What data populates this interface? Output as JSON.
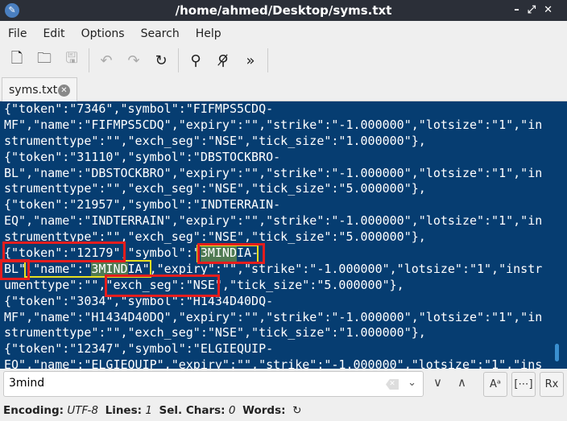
{
  "window": {
    "title": "/home/ahmed/Desktop/syms.txt",
    "controls": [
      "–",
      "⤢",
      "✕"
    ]
  },
  "menu": [
    "File",
    "Edit",
    "Options",
    "Search",
    "Help"
  ],
  "toolbar": {
    "icons": [
      "new-file-icon",
      "open-file-icon",
      "save-icon",
      "undo-icon",
      "redo-icon",
      "reload-icon",
      "find-icon",
      "find-replace-icon",
      "more-icon"
    ]
  },
  "tab": {
    "label": "syms.txt"
  },
  "editor": {
    "lines": [
      "{\"token\":\"7346\",\"symbol\":\"FIFMPS5CDQ-",
      "MF\",\"name\":\"FIFMPS5CDQ\",\"expiry\":\"\",\"strike\":\"-1.000000\",\"lotsize\":\"1\",\"in",
      "strumenttype\":\"\",\"exch_seg\":\"NSE\",\"tick_size\":\"1.000000\"},",
      "{\"token\":\"31110\",\"symbol\":\"DBSTOCKBRO-",
      "BL\",\"name\":\"DBSTOCKBRO\",\"expiry\":\"\",\"strike\":\"-1.000000\",\"lotsize\":\"1\",\"in",
      "strumenttype\":\"\",\"exch_seg\":\"NSE\",\"tick_size\":\"5.000000\"},",
      "{\"token\":\"21957\",\"symbol\":\"INDTERRAIN-",
      "EQ\",\"name\":\"INDTERRAIN\",\"expiry\":\"\",\"strike\":\"-1.000000\",\"lotsize\":\"1\",\"in",
      "strumenttype\":\"\",\"exch_seg\":\"NSE\",\"tick_size\":\"5.000000\"},",
      "{\"token\":\"12179\",\"symbol\":\"3MINDIA-",
      "BL\",\"name\":\"3MINDIA\",\"expiry\":\"\",\"strike\":\"-1.000000\",\"lotsize\":\"1\",\"instr",
      "umenttype\":\"\",\"exch_seg\":\"NSE\",\"tick_size\":\"5.000000\"},",
      "{\"token\":\"3034\",\"symbol\":\"H1434D40DQ-",
      "MF\",\"name\":\"H1434D40DQ\",\"expiry\":\"\",\"strike\":\"-1.000000\",\"lotsize\":\"1\",\"in",
      "strumenttype\":\"\",\"exch_seg\":\"NSE\",\"tick_size\":\"1.000000\"},",
      "{\"token\":\"12347\",\"symbol\":\"ELGIEQUIP-",
      "EQ\",\"name\":\"ELGIEQUIP\",\"expiry\":\"\",\"strike\":\"-1.000000\",\"lotsize\":\"1\",\"ins"
    ],
    "match_highlight_color": "#4f7a52",
    "annotation_color": "#e51d1d",
    "background": "#063d71"
  },
  "find": {
    "value": "3mind",
    "options": [
      "Aᵃ",
      "[⋯]",
      "Rx"
    ]
  },
  "status": {
    "encoding_label": "Encoding:",
    "encoding": "UTF-8",
    "lines_label": "Lines:",
    "lines": "1",
    "sel_label": "Sel. Chars:",
    "sel": "0",
    "words_label": "Words:"
  }
}
